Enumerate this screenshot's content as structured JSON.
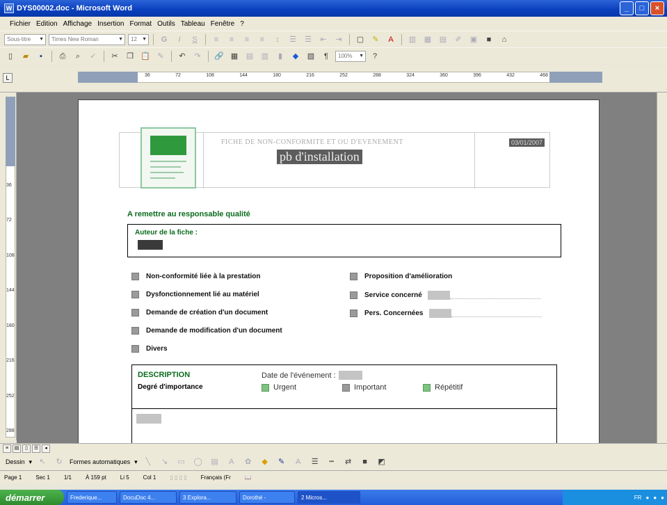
{
  "window": {
    "title": "DYS00002.doc - Microsoft Word"
  },
  "menu": [
    "Fichier",
    "Edition",
    "Affichage",
    "Insertion",
    "Format",
    "Outils",
    "Tableau",
    "Fenêtre",
    "?"
  ],
  "toolbar": {
    "style_value": "Sous-titre",
    "font_value": "Times New Roman",
    "size_value": "12",
    "zoom_value": "100%"
  },
  "ruler": {
    "h_ticks": [
      "36",
      "72",
      "108",
      "144",
      "180",
      "216",
      "252",
      "288",
      "324",
      "360",
      "396",
      "432",
      "468"
    ],
    "v_ticks": [
      "36",
      "72",
      "108",
      "144",
      "180",
      "216",
      "252",
      "288"
    ]
  },
  "document": {
    "header": {
      "fiche_title": "FICHE DE NON-CONFORMITE ET OU D'EVENEMENT",
      "subject": "pb d'installation",
      "date": "03/01/2007"
    },
    "remettre": "A remettre au responsable qualité",
    "auteur_label": "Auteur de la fiche :",
    "checkboxes_left": [
      "Non-conformité liée à la prestation",
      "Dysfonctionnement lié au matériel",
      "Demande de création d'un document",
      "Demande de modification d'un document",
      "Divers"
    ],
    "checkboxes_right": [
      "Proposition d'amélioration",
      "Service concerné",
      "Pers. Concernées"
    ],
    "description": {
      "title": "DESCRIPTION",
      "date_label": "Date de l'événement :",
      "degre_label": "Degré d'importance",
      "levels": [
        "Urgent",
        "Important",
        "Répétitif"
      ]
    }
  },
  "drawbar": {
    "dessin": "Dessin",
    "formes": "Formes automatiques"
  },
  "status": {
    "page": "Page 1",
    "sec": "Sec 1",
    "pages": "1/1",
    "at": "À 159 pt",
    "line": "Li 5",
    "col": "Col 1",
    "lang": "Français (Fr"
  },
  "taskbar": {
    "start": "démarrer",
    "tasks": [
      "Frederique...",
      "DocuDoc 4...",
      "3 Explora...",
      "Dorothé -",
      "2 Micros..."
    ]
  }
}
